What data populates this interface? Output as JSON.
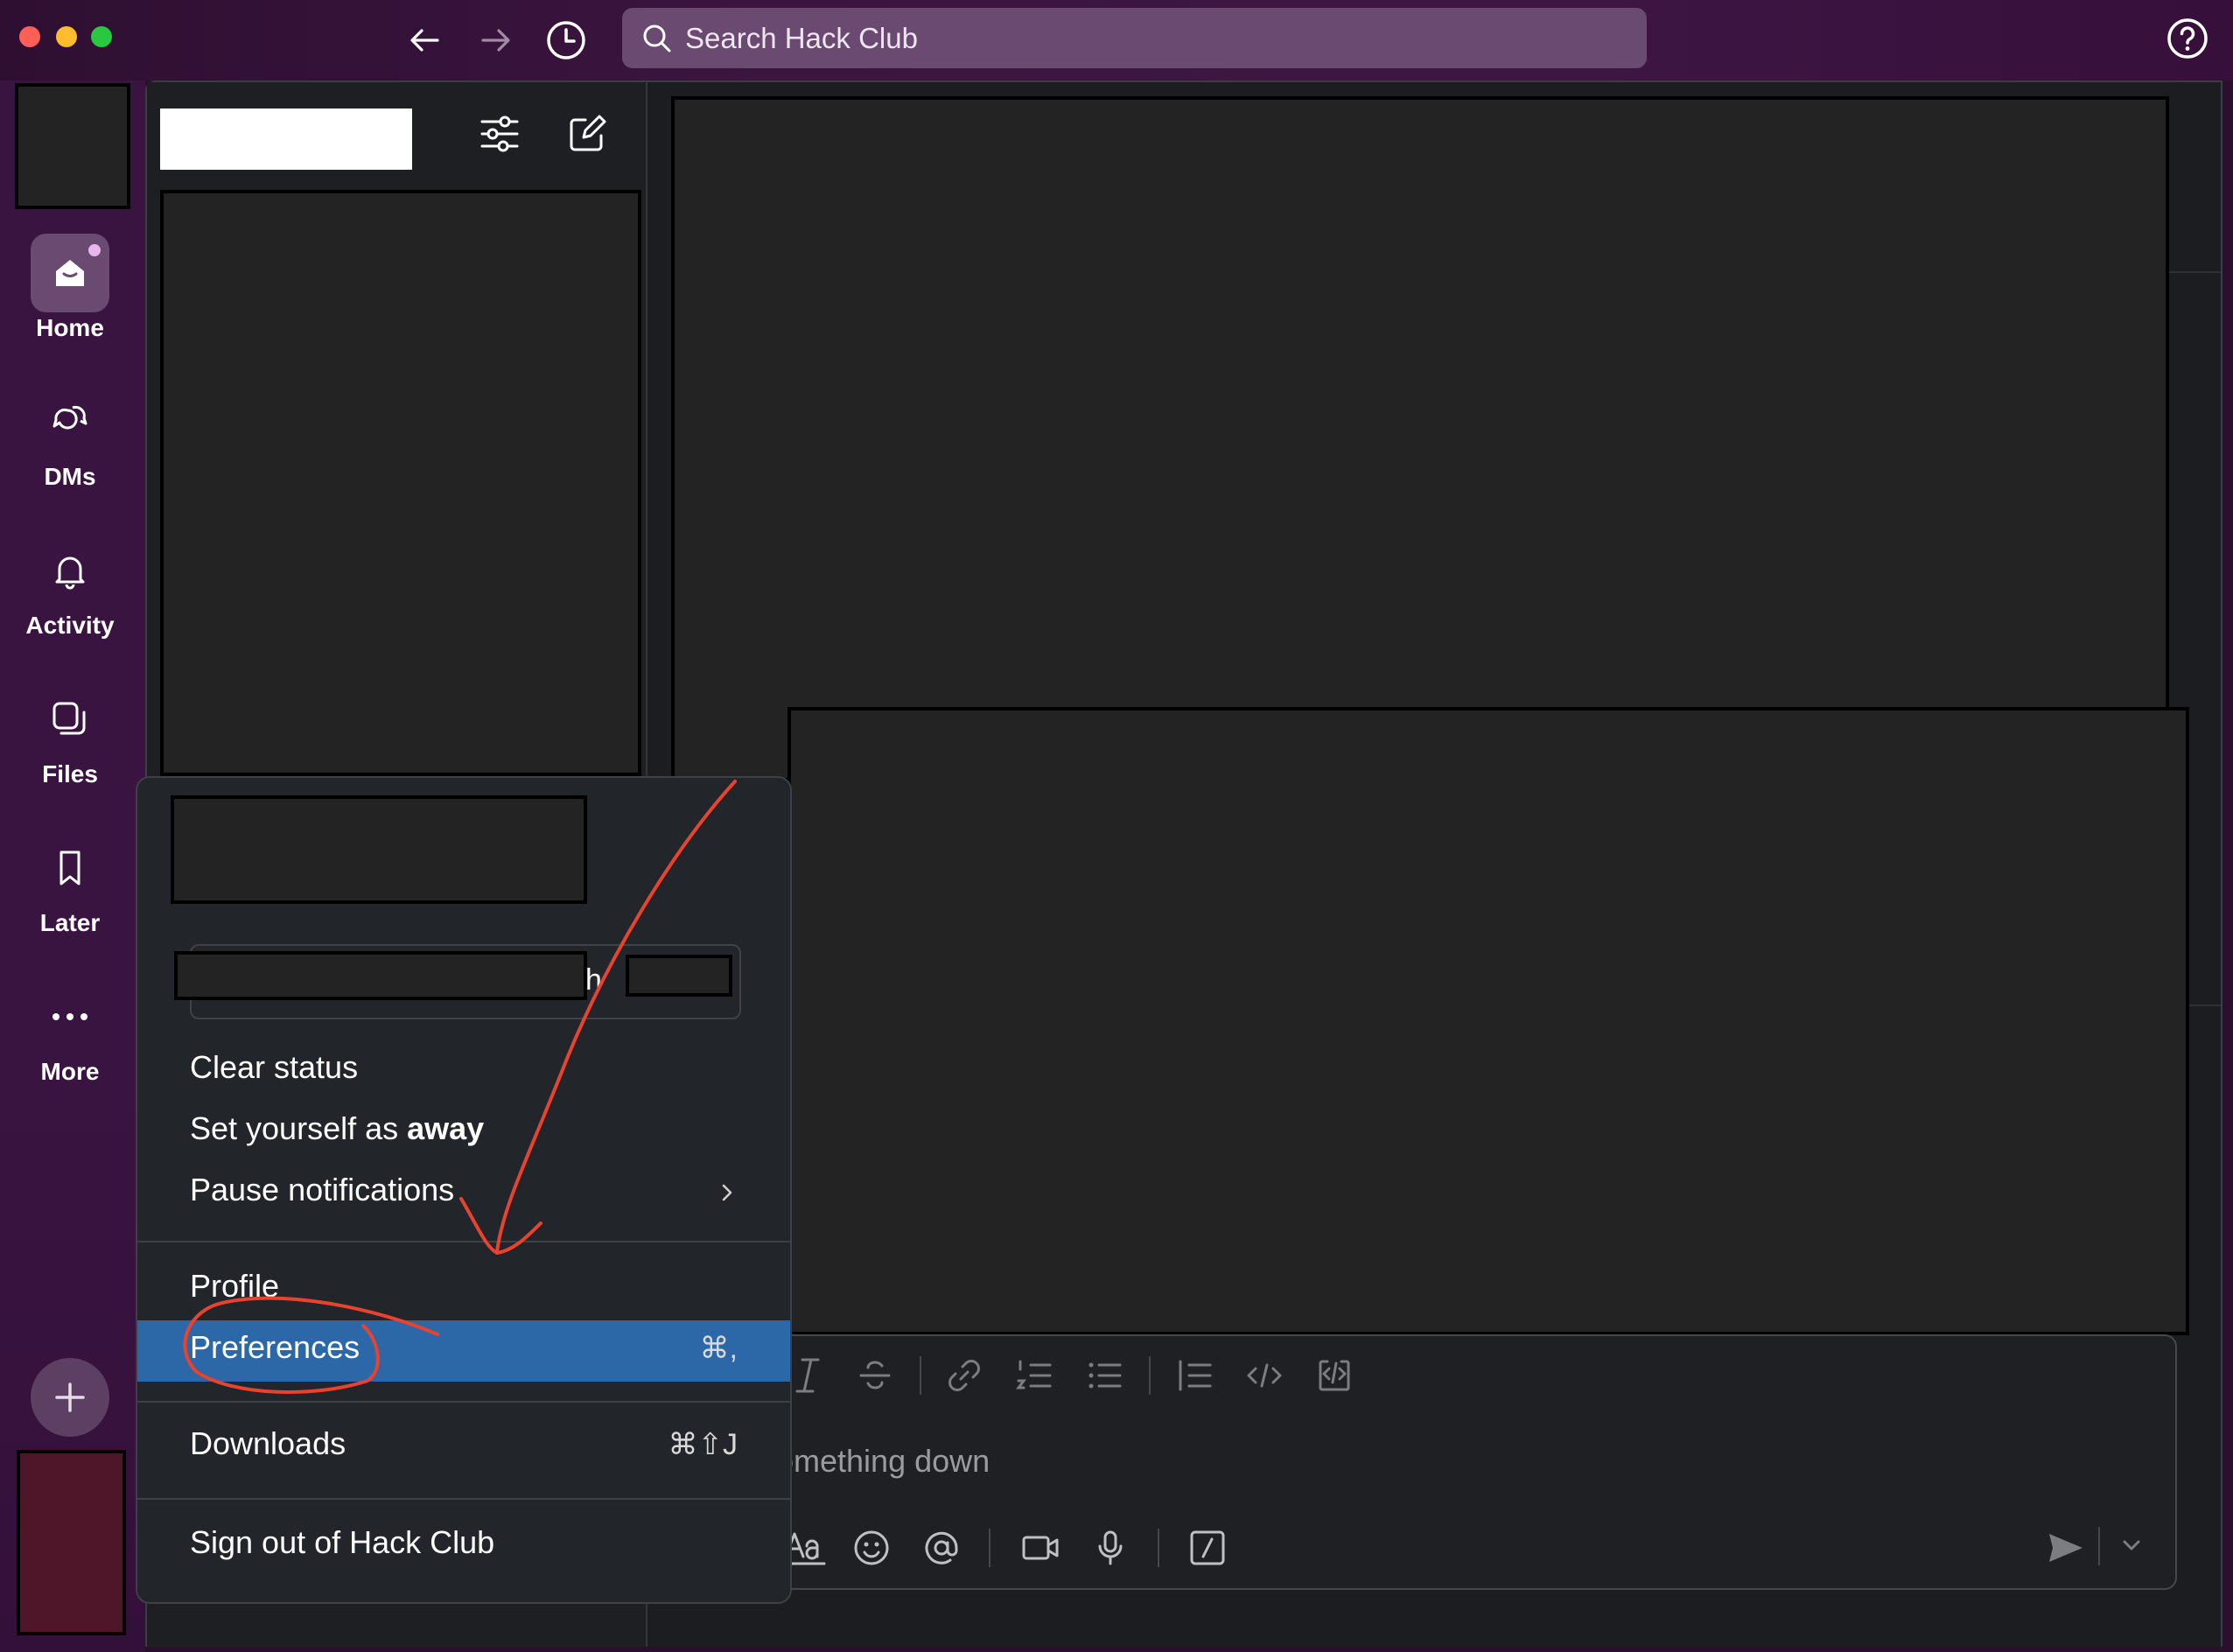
{
  "colors": {
    "window_bg": "#2b0f2e",
    "rail_bg": "#3a1440",
    "search_bg": "#6a4a70",
    "menu_bg": "#222529",
    "highlight": "#2c68a8",
    "annotation": "#e8432f",
    "redaction": "#232323"
  },
  "window": {
    "traffic_lights": [
      "close",
      "minimize",
      "zoom"
    ],
    "traffic_colors": [
      "#fe5f57",
      "#febc2e",
      "#28c840"
    ]
  },
  "toolbar": {
    "back_icon": "arrow-left-icon",
    "forward_icon": "arrow-right-icon",
    "history_icon": "clock-icon",
    "search_placeholder": "Search Hack Club",
    "help_icon": "help-icon"
  },
  "rail": {
    "items": [
      {
        "label": "Home",
        "icon": "home-icon"
      },
      {
        "label": "DMs",
        "icon": "dms-icon"
      },
      {
        "label": "Activity",
        "icon": "bell-icon"
      },
      {
        "label": "Files",
        "icon": "files-icon"
      },
      {
        "label": "Later",
        "icon": "bookmark-icon"
      },
      {
        "label": "More",
        "icon": "more-icon"
      }
    ],
    "add_icon": "plus-icon"
  },
  "sidebar": {
    "filter_icon": "filter-icon",
    "compose_icon": "compose-icon"
  },
  "status_box": {
    "partial_text": "h"
  },
  "menu": {
    "clear_status": "Clear status",
    "set_away_prefix": "Set yourself as ",
    "set_away_bold": "away",
    "pause_notifications": "Pause notifications",
    "profile": "Profile",
    "preferences": "Preferences",
    "preferences_shortcut": "⌘,",
    "downloads": "Downloads",
    "downloads_shortcut": "⌘⇧J",
    "sign_out": "Sign out of Hack Club"
  },
  "composer": {
    "placeholder_partial": "omething down",
    "format_icons": [
      "italic-icon",
      "strikethrough-icon",
      "link-icon",
      "ordered-list-icon",
      "bulleted-list-icon",
      "blockquote-icon",
      "code-icon",
      "code-block-icon"
    ],
    "action_icons": [
      "text-format-icon",
      "emoji-icon",
      "mention-icon",
      "video-icon",
      "microphone-icon",
      "slash-command-icon"
    ],
    "send_icon": "send-icon",
    "send_options_icon": "chevron-down-icon"
  }
}
